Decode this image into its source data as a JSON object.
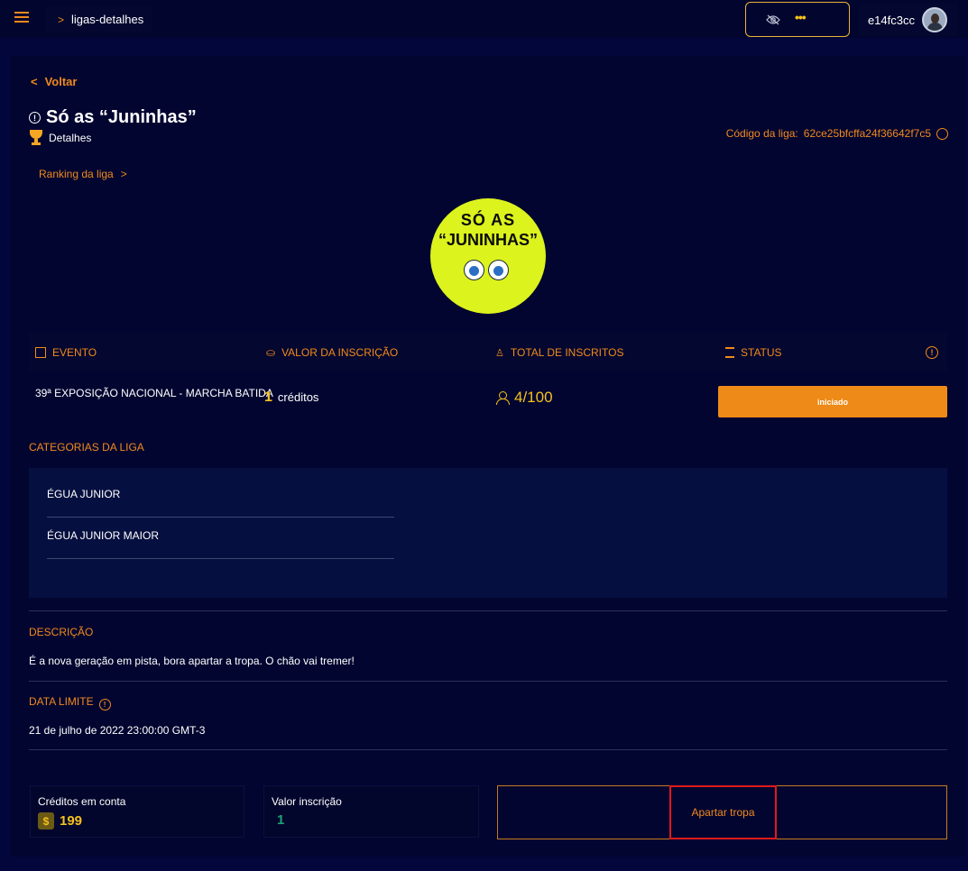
{
  "topbar": {
    "breadcrumb": "ligas-detalhes",
    "more_label": "•••",
    "user_id": "e14fc3cc"
  },
  "nav": {
    "back_label": "Voltar",
    "ranking_label": "Ranking da liga"
  },
  "league": {
    "name": "Só as “Juninhas”",
    "details_label": "Detalhes",
    "code_label": "Código da liga:",
    "code_value": "62ce25bfcffa24f36642f7c5",
    "logo_line1": "SÓ AS",
    "logo_line2": "“JUNINHAS”"
  },
  "info": {
    "headers": {
      "evento": "EVENTO",
      "valor": "VALOR DA INSCRIÇÃO",
      "total": "TOTAL DE INSCRITOS",
      "status": "STATUS"
    },
    "evento_value": "39ª EXPOSIÇÃO NACIONAL - MARCHA BATIDA",
    "valor_number": "1",
    "valor_unit": "créditos",
    "total_value": "4/100",
    "status_value": "iniciado"
  },
  "categories": {
    "title": "CATEGORIAS DA LIGA",
    "items": [
      "ÉGUA JUNIOR",
      "ÉGUA JUNIOR MAIOR"
    ]
  },
  "description": {
    "title": "DESCRIÇÃO",
    "text": "É a nova geração em pista, bora apartar a tropa. O chão vai tremer!"
  },
  "deadline": {
    "title": "DATA LIMITE",
    "value": "21 de julho de 2022 23:00:00 GMT-3"
  },
  "footer": {
    "credits_label": "Créditos em conta",
    "credits_symbol": "$",
    "credits_value": "199",
    "fee_label": "Valor inscrição",
    "fee_value": "1",
    "action_label": "Apartar tropa"
  },
  "colors": {
    "accent": "#f08a1c",
    "gold": "#f5c11d",
    "background": "#03063a",
    "fee_green": "#1fa37a"
  }
}
